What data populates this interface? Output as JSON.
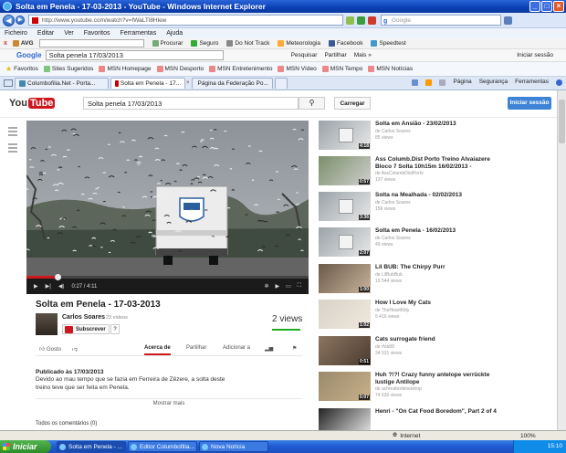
{
  "window": {
    "title": "Solta em Penela - 17-03-2013 - YouTube - Windows Internet Explorer"
  },
  "address_bar": {
    "url": "http://www.youtube.com/watch?v=fWaLTl8Hlew",
    "search_placeholder": "Google"
  },
  "menu": [
    "Ficheiro",
    "Editar",
    "Ver",
    "Favoritos",
    "Ferramentas",
    "Ajuda"
  ],
  "avg_toolbar": {
    "brand": "AVG",
    "items": [
      "Procurar",
      "Seguro",
      "Do Not Track",
      "Meteorologia",
      "Facebook",
      "Speedtest"
    ]
  },
  "google_toolbar": {
    "brand": "Google",
    "query": "Solta penela 17/03/2013",
    "items": [
      "Pesquisar",
      "Partilhar",
      "Mais »"
    ],
    "signin": "Iniciar sessão"
  },
  "favorites_bar": {
    "favorites_label": "Favoritos",
    "items": [
      "Sites Sugeridos",
      "MSN Homepage",
      "MSN Desporto",
      "MSN Entretenimento",
      "MSN Vídeo",
      "MSN Tempo",
      "MSN Notícias"
    ]
  },
  "tabs": [
    {
      "label": "Columbofilia.Net - Porta...",
      "active": false
    },
    {
      "label": "Solta em Penela - 17...",
      "active": true
    },
    {
      "label": "Página da Federação Po...",
      "active": false
    }
  ],
  "browser_tools": [
    "Página",
    "Segurança",
    "Ferramentas"
  ],
  "youtube": {
    "logo_you": "You",
    "logo_tube": "Tube",
    "search_value": "Solta penela 17/03/2013",
    "upload_label": "Carregar",
    "signin_label": "Iniciar sessão"
  },
  "player": {
    "time_current": "0:27",
    "time_total": "4:11",
    "progress": 0.11
  },
  "video": {
    "title": "Solta em Penela - 17-03-2013",
    "channel": "Carlos Soares",
    "video_count": "23 vídeos",
    "subscribe_label": "Subscrever",
    "subscriber_count": "?",
    "views": "2 views",
    "actions": [
      "Gosto",
      "Acerca de",
      "Partilhar",
      "Adicionar a"
    ],
    "published": "Publicado às 17/03/2013",
    "description": "Devido ao mau tempo que se fazia em Ferreira de Zêzere, a solta deste treino teve que ser feita em Penela.",
    "show_more": "Mostrar mais",
    "comments": "Todos os comentários (0)"
  },
  "related": [
    {
      "title": "Solta em Ansião - 23/02/2013",
      "by": "de Carlos Soares",
      "views": "85 views",
      "duration": "4:18",
      "thumb": "truck"
    },
    {
      "title": "Ass Columb.Dist Porto Treino Alvaiazere Bloco 7 Solta 10h15m 16/02/2013 -",
      "by": "de AssColumbDistPorto",
      "views": "137 views",
      "duration": "0:57",
      "thumb": "road"
    },
    {
      "title": "Solta na Mealhada - 02/02/2013",
      "by": "de Carlos Soares",
      "views": "156 views",
      "duration": "3:36",
      "thumb": "truck"
    },
    {
      "title": "Solta em Penela - 16/02/2013",
      "by": "de Carlos Soares",
      "views": "49 views",
      "duration": "2:07",
      "thumb": "truck"
    },
    {
      "title": "Lil BUB: The Chirpy Purr",
      "by": "de LilBubBub",
      "views": "19 544 views",
      "duration": "1:00",
      "thumb": "cat"
    },
    {
      "title": "How I Love My Cats",
      "by": "de TheHeartKitty",
      "views": "5 416 views",
      "duration": "1:02",
      "thumb": "man"
    },
    {
      "title": "Cats surrogate friend",
      "by": "de rfsb88",
      "views": "34 531 views",
      "duration": "0:51",
      "thumb": "kitten"
    },
    {
      "title": "Huh ?!?! Crazy funny antelope verrückte lustige Antilope",
      "by": "de achreaborbinelshop",
      "views": "74 630 views",
      "duration": "0:07",
      "thumb": "antelope"
    },
    {
      "title": "Henri - \"On Cat Food Boredom\", Part 2 of 4",
      "by": "",
      "views": "",
      "duration": "",
      "thumb": "cat2"
    }
  ],
  "statusbar": {
    "zone": "Internet",
    "zoom": "100%"
  },
  "taskbar": {
    "start": "Iniciar",
    "tasks": [
      "Solta em Penela - ...",
      "Editor Columbofilia...",
      "Nova Notícia"
    ],
    "clock": "15:10"
  }
}
